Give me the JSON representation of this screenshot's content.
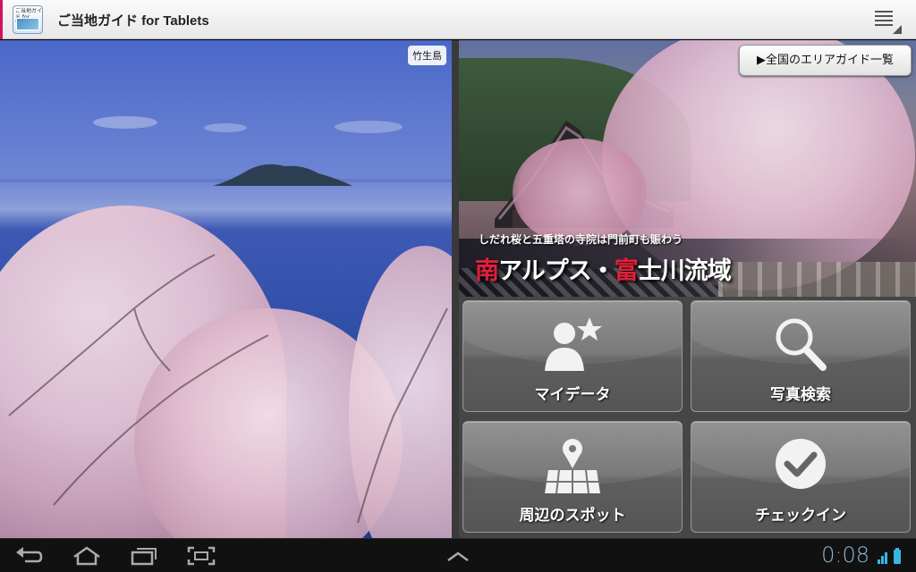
{
  "app": {
    "title": "ご当地ガイド for Tablets",
    "icon_text": "ご当地ガイド for Tablets",
    "menu_icon": "overflow-menu-icon"
  },
  "left_panel": {
    "place_label": "竹生島"
  },
  "promo": {
    "area_guide_button": "▶全国のエリアガイド一覧",
    "subtitle": "しだれ桜と五重塔の寺院は門前町も賑わう",
    "title_parts": [
      "南",
      "アルプス・",
      "富",
      "士川流域"
    ]
  },
  "tiles": [
    {
      "id": "mydata",
      "label": "マイデータ",
      "icon": "person-star-icon"
    },
    {
      "id": "photo",
      "label": "写真検索",
      "icon": "magnifier-icon"
    },
    {
      "id": "nearby",
      "label": "周辺のスポット",
      "icon": "map-pin-icon"
    },
    {
      "id": "checkin",
      "label": "チェックイン",
      "icon": "checkmark-circle-icon"
    }
  ],
  "system_bar": {
    "time": "0:08",
    "buttons": [
      "back-icon",
      "home-icon",
      "recent-apps-icon",
      "screenshot-icon"
    ],
    "center": "chevron-up-icon",
    "status": [
      "signal-icon",
      "battery-icon"
    ]
  },
  "colors": {
    "accent": "#d0145a",
    "clock": "#8ab8cf",
    "title_highlight": "#e0203a"
  }
}
